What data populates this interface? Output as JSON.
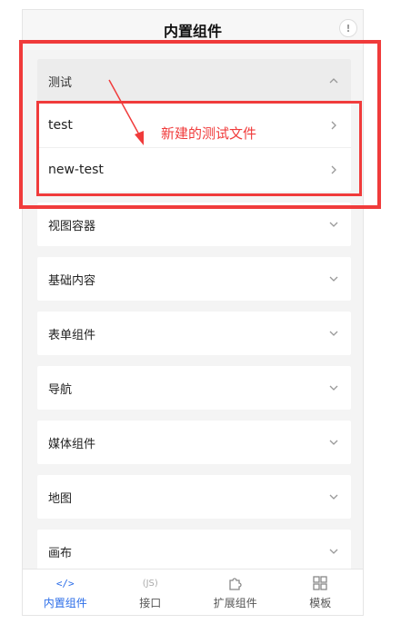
{
  "header": {
    "title": "内置组件",
    "info_glyph": "!"
  },
  "categories": [
    {
      "label": "测试",
      "expanded": true,
      "items": [
        "test",
        "new-test"
      ]
    },
    {
      "label": "视图容器",
      "expanded": false
    },
    {
      "label": "基础内容",
      "expanded": false
    },
    {
      "label": "表单组件",
      "expanded": false
    },
    {
      "label": "导航",
      "expanded": false
    },
    {
      "label": "媒体组件",
      "expanded": false
    },
    {
      "label": "地图",
      "expanded": false
    },
    {
      "label": "画布",
      "expanded": false
    }
  ],
  "tabbar": {
    "tabs": [
      {
        "label": "内置组件",
        "icon": "code-icon",
        "glyph": "</>",
        "active": true
      },
      {
        "label": "接口",
        "icon": "js-icon",
        "glyph": "(JS)"
      },
      {
        "label": "扩展组件",
        "icon": "puzzle-icon"
      },
      {
        "label": "模板",
        "icon": "template-icon"
      }
    ]
  },
  "annotation": {
    "text": "新建的测试文件",
    "color": "#f03b3b"
  },
  "colors": {
    "accent": "#2b6de8",
    "annotation": "#f03b3b"
  }
}
